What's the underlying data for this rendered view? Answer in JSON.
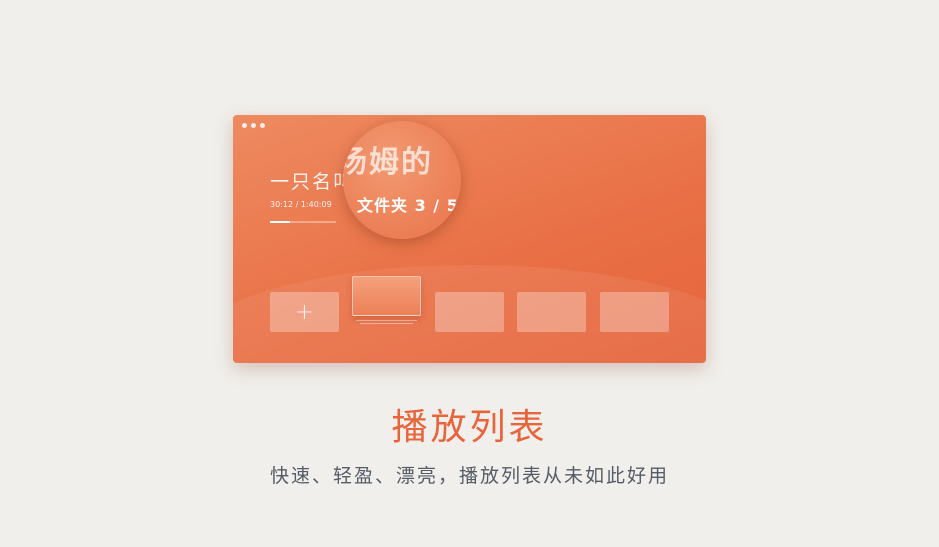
{
  "window": {
    "track_title": "一只名叫",
    "time": "30:12 / 1:40:09",
    "progress": 0.3,
    "magnifier": {
      "title": "汤姆的",
      "folder": "文件夹 3 / 5"
    },
    "playlist": {
      "add_label": "+"
    }
  },
  "heading": "播放列表",
  "subheading": "快速、轻盈、漂亮，播放列表从未如此好用",
  "colors": {
    "accent": "#e8643b",
    "window_start": "#ee8a60",
    "window_end": "#e5643b",
    "background": "#f1efeb",
    "subtext": "#555c66"
  }
}
